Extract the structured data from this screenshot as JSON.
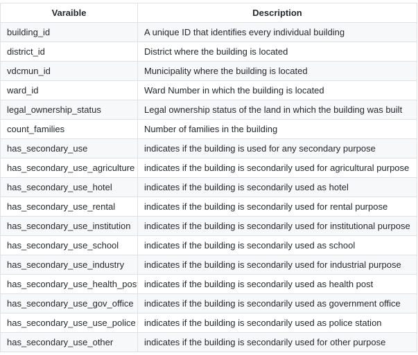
{
  "table": {
    "headers": {
      "variable": "Varaible",
      "description": "Description"
    },
    "rows": [
      {
        "variable": "building_id",
        "description": "A unique ID that identifies every individual building"
      },
      {
        "variable": "district_id",
        "description": "District where the building is located"
      },
      {
        "variable": "vdcmun_id",
        "description": "Municipality where the building is located"
      },
      {
        "variable": "ward_id",
        "description": "Ward Number in which the building is located"
      },
      {
        "variable": "legal_ownership_status",
        "description": "Legal ownership status of the land in which the building was built"
      },
      {
        "variable": "count_families",
        "description": "Number of families in the building"
      },
      {
        "variable": "has_secondary_use",
        "description": "indicates if the building is used for any secondary purpose"
      },
      {
        "variable": "has_secondary_use_agriculture",
        "description": "indicates if the building is secondarily used for agricultural purpose"
      },
      {
        "variable": "has_secondary_use_hotel",
        "description": "indicates if the building is secondarily used as hotel"
      },
      {
        "variable": "has_secondary_use_rental",
        "description": "indicates if the building is secondarily used for rental purpose"
      },
      {
        "variable": "has_secondary_use_institution",
        "description": "indicates if the building is secondarily used for institutional purpose"
      },
      {
        "variable": "has_secondary_use_school",
        "description": "indicates if the building is secondarily used as school"
      },
      {
        "variable": "has_secondary_use_industry",
        "description": "indicates if the building is secondarily used for industrial purpose"
      },
      {
        "variable": "has_secondary_use_health_post",
        "description": "indicates if the building is secondarily used as health post"
      },
      {
        "variable": "has_secondary_use_gov_office",
        "description": "indicates if the building is secondarily used as government office"
      },
      {
        "variable": "has_secondary_use_use_police",
        "description": "indicates if the building is secondarily used as police station"
      },
      {
        "variable": "has_secondary_use_other",
        "description": "indicates if the building is secondarily used for other purpose"
      }
    ]
  }
}
